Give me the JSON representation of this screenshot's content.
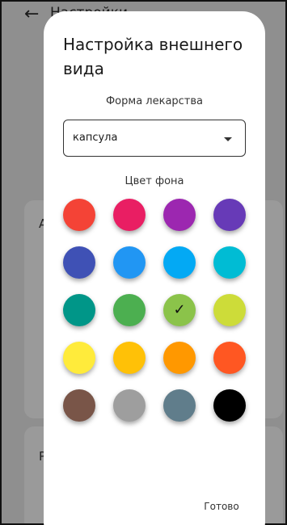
{
  "background": {
    "back_icon": "arrow-left-icon",
    "title": "Настройки",
    "card_letters": [
      "А",
      "Р"
    ]
  },
  "dialog": {
    "title": "Настройка внешнего вида",
    "shape_label": "Форма лекарства",
    "shape_value": "капсула",
    "color_label": "Цвет фона",
    "done_label": "Готово",
    "selected_check": "✓",
    "colors": [
      "#f44336",
      "#e91e63",
      "#9c27b0",
      "#673ab7",
      "#3f51b5",
      "#2196f3",
      "#03a9f4",
      "#00bcd4",
      "#009688",
      "#4caf50",
      "#8bc34a",
      "#cddc39",
      "#ffeb3b",
      "#ffc107",
      "#ff9800",
      "#ff5722",
      "#795548",
      "#9e9e9e",
      "#607d8b",
      "#000000"
    ],
    "selected_index": 10
  }
}
